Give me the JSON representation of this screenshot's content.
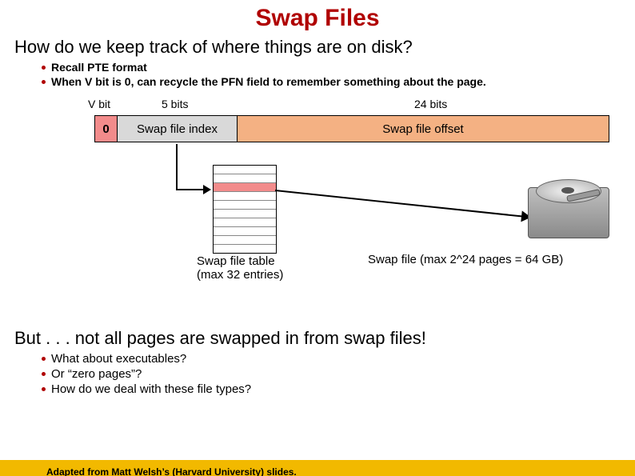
{
  "title": "Swap Files",
  "question1": "How do we keep track of where things are on disk?",
  "bullets1": {
    "b0": "Recall PTE format",
    "b1": "When V bit is 0, can recycle the PFN field to remember something about the page."
  },
  "labels": {
    "vbit": "V bit",
    "fivebits": "5 bits",
    "twentyfourbits": "24 bits"
  },
  "pte": {
    "vbit_value": "0",
    "index_label": "Swap file index",
    "offset_label": "Swap file offset"
  },
  "swapfile_caption": "Swap file (max 2^24 pages = 64 GB)",
  "sft_caption_line1": "Swap file table",
  "sft_caption_line2": "(max 32 entries)",
  "question2": "But . . . not all pages are swapped in from swap files!",
  "bullets2": {
    "b0": "What about executables?",
    "b1": "Or “zero pages”?",
    "b2": "How do we deal with these file types?"
  },
  "footer": "Adapted from Matt Welsh’s (Harvard University) slides."
}
